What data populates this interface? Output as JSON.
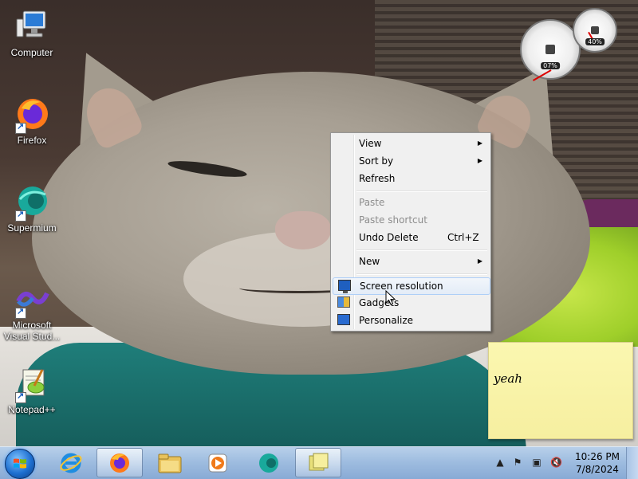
{
  "desktop": {
    "icons": [
      {
        "label": "Computer",
        "icon": "computer-icon"
      },
      {
        "label": "Firefox",
        "icon": "firefox-icon"
      },
      {
        "label": "Supermium",
        "icon": "supermium-icon"
      },
      {
        "label": "Microsoft Visual Stud...",
        "icon": "visual-studio-icon"
      },
      {
        "label": "Notepad++",
        "icon": "notepad-plus-plus-icon"
      }
    ]
  },
  "gadgets": {
    "cpu_meter": {
      "cpu_label": "07%",
      "memory_label": "40%"
    }
  },
  "context_menu": {
    "items": [
      {
        "label": "View",
        "submenu": true
      },
      {
        "label": "Sort by",
        "submenu": true
      },
      {
        "label": "Refresh"
      },
      {
        "label": "Paste",
        "disabled": true
      },
      {
        "label": "Paste shortcut",
        "disabled": true
      },
      {
        "label": "Undo Delete",
        "shortcut": "Ctrl+Z"
      },
      {
        "label": "New",
        "submenu": true
      },
      {
        "label": "Screen resolution",
        "icon": "screen-resolution-icon",
        "highlighted": true
      },
      {
        "label": "Gadgets",
        "icon": "gadgets-icon"
      },
      {
        "label": "Personalize",
        "icon": "personalize-icon"
      }
    ]
  },
  "sticky_note": {
    "text": "yeah"
  },
  "taskbar": {
    "pinned": [
      {
        "name": "internet-explorer"
      },
      {
        "name": "firefox",
        "active": true
      },
      {
        "name": "file-explorer"
      },
      {
        "name": "media-player"
      },
      {
        "name": "supermium"
      },
      {
        "name": "sticky-notes",
        "active": true
      }
    ],
    "clock": {
      "time": "10:26 PM",
      "date": "7/8/2024"
    }
  },
  "colors": {
    "taskbar": "#9fbde0",
    "menu_bg": "#f0f0f0",
    "note_bg": "#f6efa0",
    "menu_highlight": "#aecff7"
  }
}
